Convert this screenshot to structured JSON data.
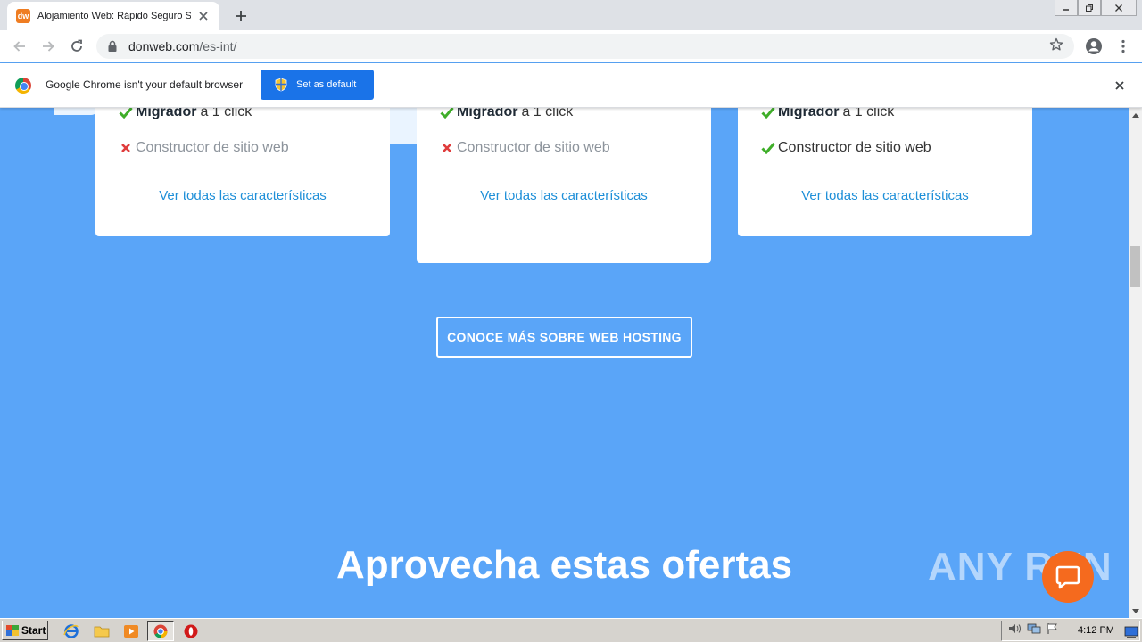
{
  "browser": {
    "tab_title": "Alojamiento Web: Rápido Seguro Sop",
    "favicon_text": "dw",
    "url_host": "donweb.com",
    "url_path": "/es-int/"
  },
  "infobar": {
    "message": "Google Chrome isn't your default browser",
    "button_label": "Set as default"
  },
  "plans": [
    {
      "features": [
        {
          "bold": "Migrador",
          "text": "a 1 click",
          "included": true
        },
        {
          "bold": "",
          "text": "Constructor de sitio web",
          "included": false
        }
      ],
      "link": "Ver todas las características"
    },
    {
      "features": [
        {
          "bold": "Migrador",
          "text": "a 1 click",
          "included": true
        },
        {
          "bold": "",
          "text": "Constructor de sitio web",
          "included": false
        }
      ],
      "link": "Ver todas las características"
    },
    {
      "features": [
        {
          "bold": "Migrador",
          "text": "a 1 click",
          "included": true
        },
        {
          "bold": "",
          "text": "Constructor de sitio web",
          "included": true
        }
      ],
      "link": "Ver todas las características"
    }
  ],
  "cta_label": "CONOCE MÁS SOBRE WEB HOSTING",
  "offers_heading": "Aprovecha estas ofertas",
  "watermark": "ANY RUN",
  "taskbar": {
    "start_label": "Start",
    "clock": "4:12 PM"
  },
  "colors": {
    "page_bg": "#5aa5f8",
    "link": "#1e8fd8",
    "check": "#3fae29",
    "cross": "#e03c3c",
    "chat_bubble": "#f56a1e",
    "primary_button": "#1a73e8"
  }
}
